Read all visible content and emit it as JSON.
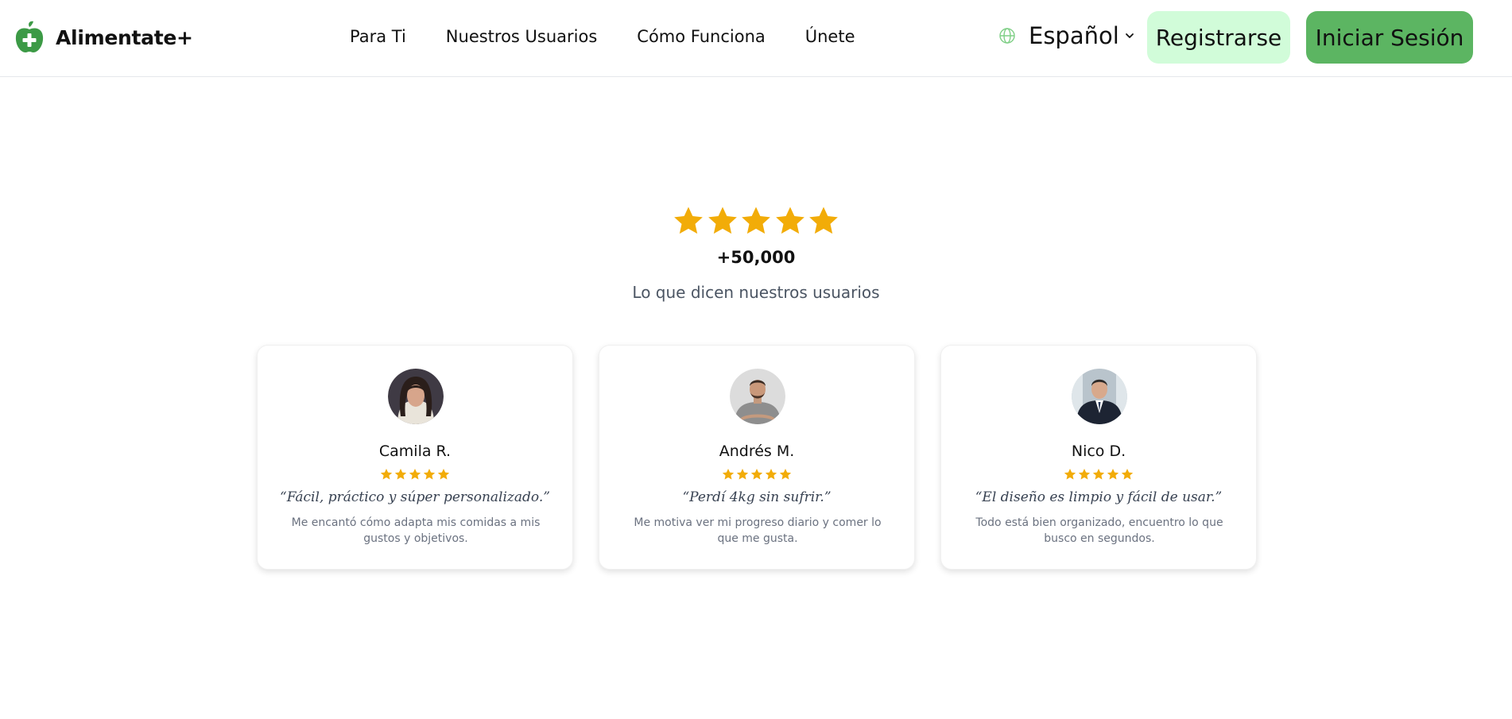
{
  "brand": {
    "name": "Alimentate+"
  },
  "nav": {
    "items": [
      {
        "label": "Para Ti"
      },
      {
        "label": "Nuestros Usuarios"
      },
      {
        "label": "Cómo Funciona"
      },
      {
        "label": "Únete"
      }
    ]
  },
  "language": {
    "selected": "Español",
    "icon": "globe-icon"
  },
  "buttons": {
    "register": "Registrarse",
    "login": "Iniciar Sesión"
  },
  "hero": {
    "rating": 5,
    "count": "+50,000",
    "subtitle": "Lo que dicen nuestros usuarios"
  },
  "testimonials": [
    {
      "name": "Camila R.",
      "rating": 5,
      "quote": "“Fácil, práctico y súper personalizado.”",
      "text": "Me encantó cómo adapta mis comidas a mis gustos y objetivos."
    },
    {
      "name": "Andrés M.",
      "rating": 5,
      "quote": "“Perdí 4kg sin sufrir.”",
      "text": "Me motiva ver mi progreso diario y comer lo que me gusta."
    },
    {
      "name": "Nico D.",
      "rating": 5,
      "quote": "“El diseño es limpio y fácil de usar.”",
      "text": "Todo está bien organizado, encuentro lo que busco en segundos."
    }
  ],
  "colors": {
    "brand_green": "#3c9a46",
    "register_bg": "#d1fcd9",
    "login_bg": "#5cb562",
    "star": "#f2ac08"
  }
}
